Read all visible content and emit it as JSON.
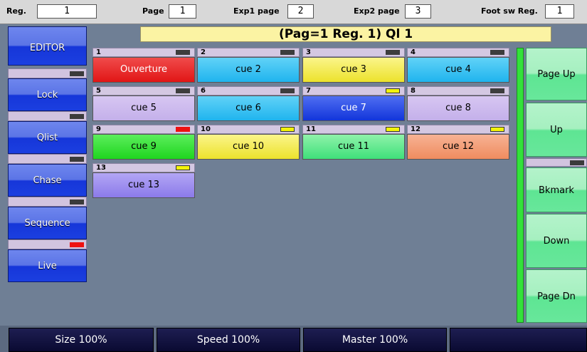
{
  "topbar": {
    "reg_label": "Reg.",
    "reg_value": "1",
    "page_label": "Page",
    "page_value": "1",
    "exp1_label": "Exp1 page",
    "exp1_value": "2",
    "exp2_label": "Exp2 page",
    "exp2_value": "3",
    "footsw_label": "Foot sw Reg.",
    "footsw_value": "1"
  },
  "title": "(Pag=1 Reg. 1) Ql 1",
  "left_menu": {
    "editor": "EDITOR",
    "lock": "Lock",
    "qlist": "Qlist",
    "chase": "Chase",
    "sequence": "Sequence",
    "live": "Live",
    "indicator_colors": [
      "#3b3b3b",
      "#3b3b3b",
      "#3b3b3b",
      "#3b3b3b",
      "#ee1111"
    ]
  },
  "cues": [
    {
      "num": "1",
      "label": "Ouverture",
      "color": "red",
      "led": "dark"
    },
    {
      "num": "2",
      "label": "cue 2",
      "color": "cyan",
      "led": "dark"
    },
    {
      "num": "3",
      "label": "cue 3",
      "color": "yellow",
      "led": "dark"
    },
    {
      "num": "4",
      "label": "cue 4",
      "color": "cyan",
      "led": "dark"
    },
    {
      "num": "5",
      "label": "cue 5",
      "color": "lavender",
      "led": "dark"
    },
    {
      "num": "6",
      "label": "cue 6",
      "color": "cyan",
      "led": "dark"
    },
    {
      "num": "7",
      "label": "cue 7",
      "color": "blue",
      "led": "yellow"
    },
    {
      "num": "8",
      "label": "cue 8",
      "color": "lavender",
      "led": "dark"
    },
    {
      "num": "9",
      "label": "cue 9",
      "color": "green",
      "led": "red"
    },
    {
      "num": "10",
      "label": "cue 10",
      "color": "yellow",
      "led": "yellow"
    },
    {
      "num": "11",
      "label": "cue 11",
      "color": "mint",
      "led": "yellow"
    },
    {
      "num": "12",
      "label": "cue 12",
      "color": "orange",
      "led": "yellow"
    },
    {
      "num": "13",
      "label": "cue 13",
      "color": "purple",
      "led": "yellow"
    }
  ],
  "right_menu": {
    "page_up": "Page Up",
    "up": "Up",
    "bkmark": "Bkmark",
    "down": "Down",
    "page_dn": "Page Dn"
  },
  "bottombar": {
    "size": "Size 100%",
    "speed": "Speed 100%",
    "master": "Master 100%",
    "empty": ""
  }
}
